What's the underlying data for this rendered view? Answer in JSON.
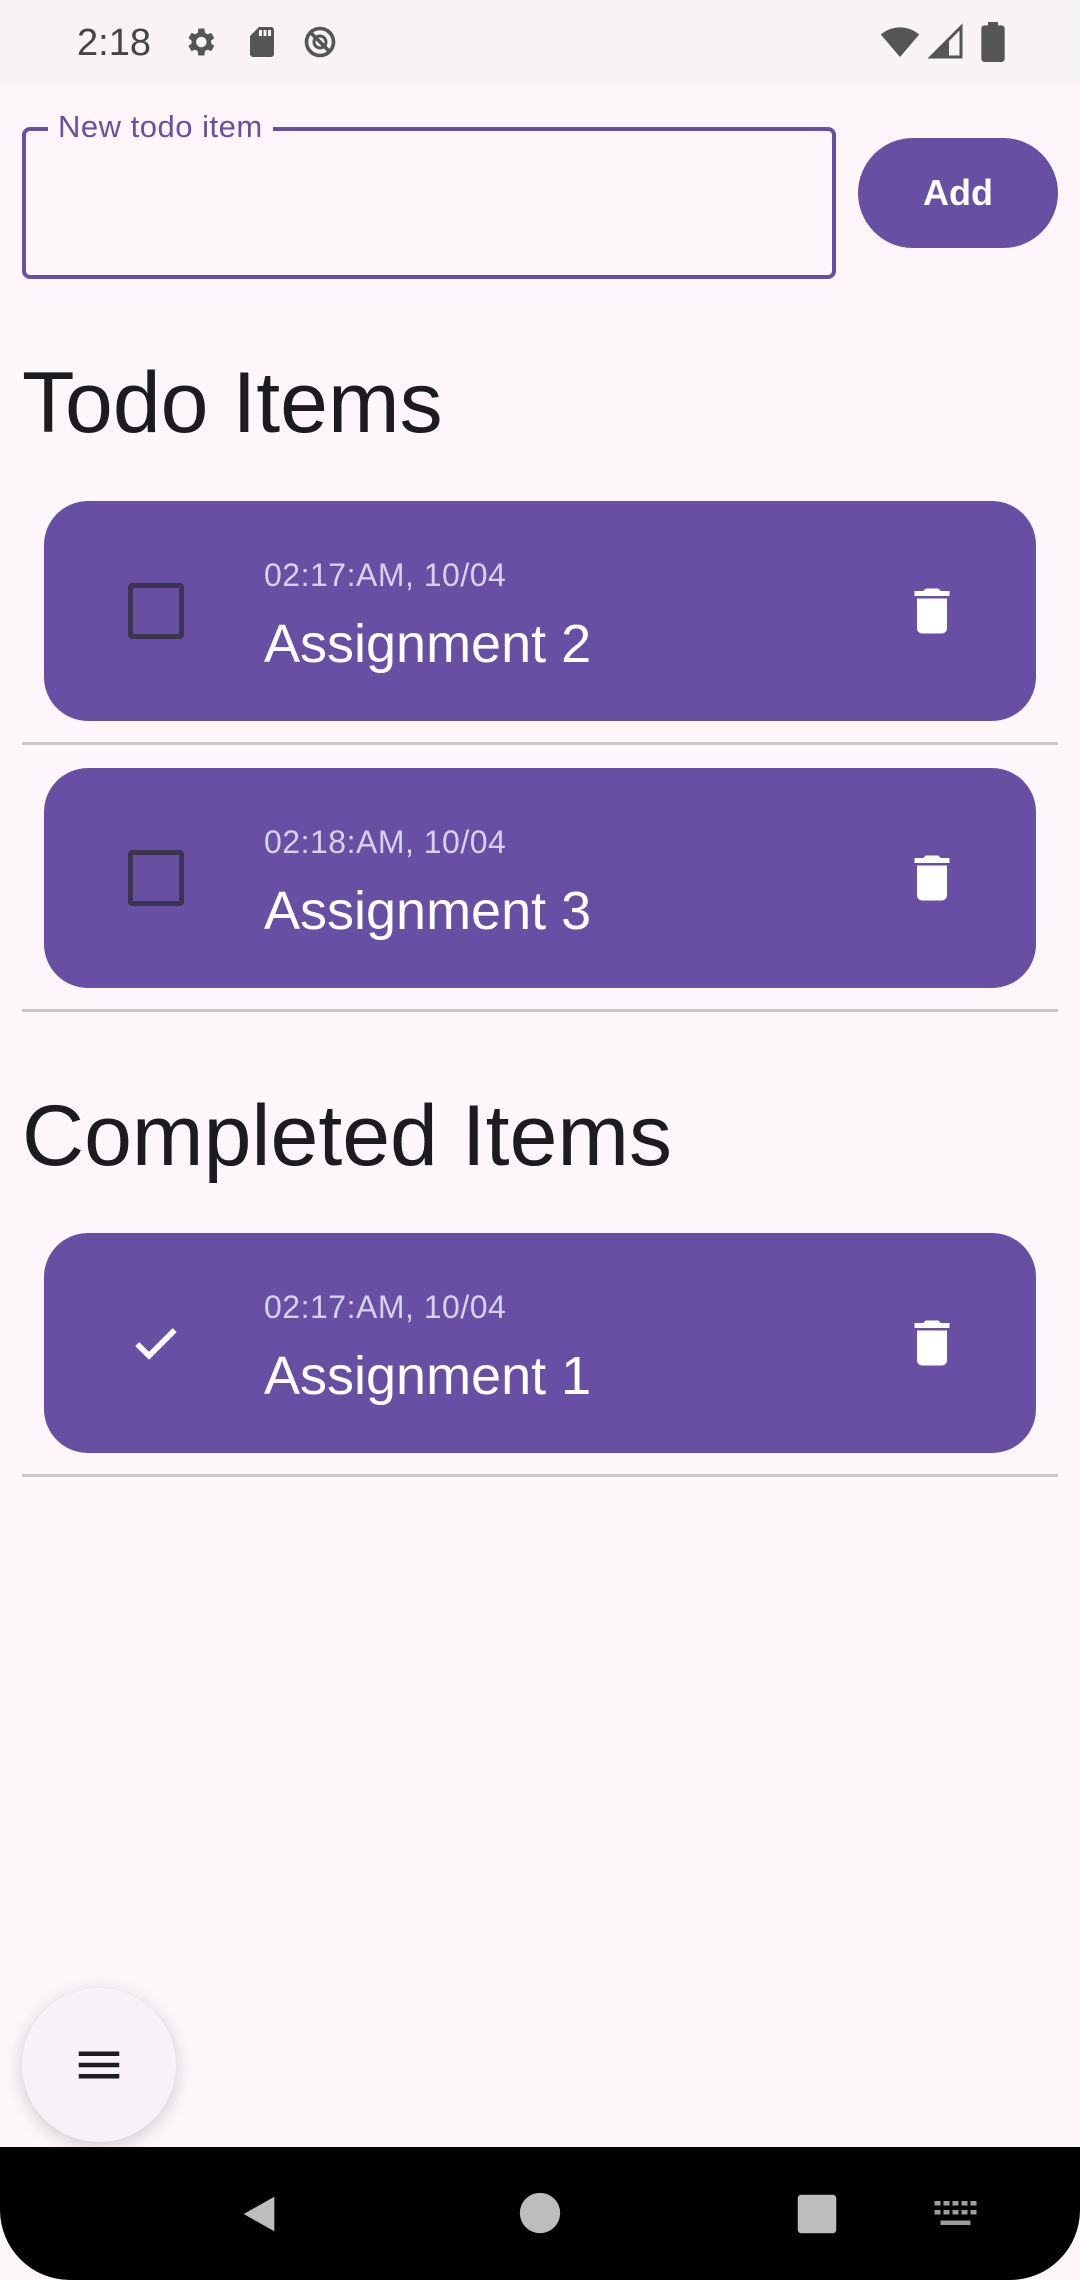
{
  "status_bar": {
    "time": "2:18",
    "icons": [
      "settings-icon",
      "sd-card-icon",
      "do-not-disturb-icon",
      "wifi-icon",
      "cell-signal-icon",
      "battery-icon"
    ]
  },
  "new_todo": {
    "label": "New todo item",
    "value": "",
    "placeholder": "",
    "add_label": "Add"
  },
  "sections": {
    "todo_title": "Todo Items",
    "completed_title": "Completed Items"
  },
  "todo_items": [
    {
      "time": "02:17:AM, 10/04",
      "title": "Assignment 2",
      "checked": false
    },
    {
      "time": "02:18:AM, 10/04",
      "title": "Assignment 3",
      "checked": false
    }
  ],
  "completed_items": [
    {
      "time": "02:17:AM, 10/04",
      "title": "Assignment 1",
      "checked": true
    }
  ],
  "fab": {
    "icon": "menu-icon"
  },
  "nav": {
    "icons": [
      "back-icon",
      "home-icon",
      "recents-icon",
      "keyboard-icon"
    ]
  },
  "colors": {
    "accent": "#6750A4",
    "background": "#FDF7FC",
    "card_text": "#FFFFFF",
    "card_subtext": "#D9D0EC"
  }
}
